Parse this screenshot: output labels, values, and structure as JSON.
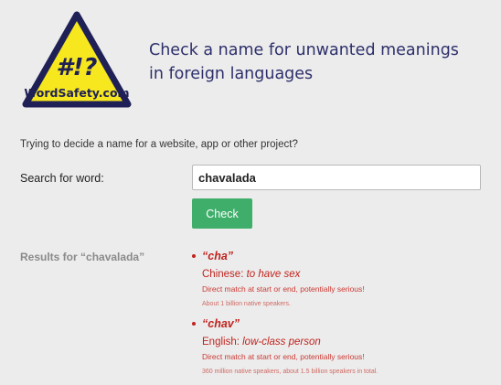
{
  "logo": {
    "symbol": "#!?",
    "site_name": "WordSafety.com",
    "colors": {
      "fill": "#f6e71f",
      "border": "#1f2056",
      "text": "#1f2056"
    }
  },
  "header": {
    "tagline": "Check a name for unwanted meanings in foreign languages"
  },
  "intro_text": "Trying to decide a name for a website, app or other project?",
  "search": {
    "label": "Search for word:",
    "value": "chavalada",
    "button_label": "Check"
  },
  "results": {
    "label_prefix": "Results for",
    "query_quoted": "“chavalada”",
    "items": [
      {
        "word": "“cha”",
        "language": "Chinese:",
        "meaning": "to have sex",
        "match_note": "Direct match at start or end, potentially serious!",
        "speakers": "About 1 billion native speakers."
      },
      {
        "word": "“chav”",
        "language": "English:",
        "meaning": "low-class person",
        "match_note": "Direct match at start or end, potentially serious!",
        "speakers": "360 million native speakers, about 1.5 billion speakers in total."
      }
    ]
  },
  "colors": {
    "background": "#ececec",
    "tagline": "#2d2f6b",
    "button": "#3fae6b",
    "result_red": "#c0231d",
    "results_label_gray": "#8a8a8a"
  }
}
